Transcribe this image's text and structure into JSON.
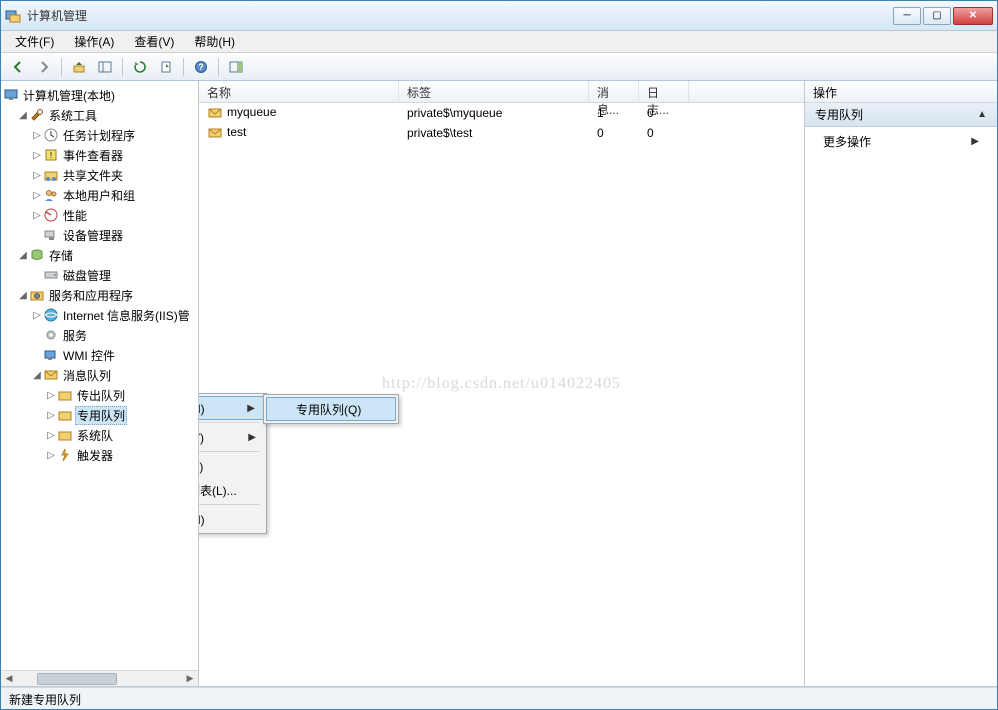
{
  "window": {
    "title": "计算机管理"
  },
  "menu": {
    "file": "文件(F)",
    "action": "操作(A)",
    "view": "查看(V)",
    "help": "帮助(H)"
  },
  "tree": {
    "root": "计算机管理(本地)",
    "system_tools": "系统工具",
    "task_scheduler": "任务计划程序",
    "event_viewer": "事件查看器",
    "shared_folders": "共享文件夹",
    "local_users": "本地用户和组",
    "performance": "性能",
    "device_manager": "设备管理器",
    "storage": "存储",
    "disk_management": "磁盘管理",
    "services_apps": "服务和应用程序",
    "iis": "Internet 信息服务(IIS)管",
    "services": "服务",
    "wmi": "WMI 控件",
    "msmq": "消息队列",
    "outgoing_queues": "传出队列",
    "private_queues": "专用队列",
    "system_queues": "系统队",
    "triggers": "触发器"
  },
  "list": {
    "columns": {
      "name": "名称",
      "tag": "标签",
      "messages": "消息...",
      "log": "日志..."
    },
    "rows": [
      {
        "name": "myqueue",
        "tag": "private$\\myqueue",
        "messages": "1",
        "log": "0"
      },
      {
        "name": "test",
        "tag": "private$\\test",
        "messages": "0",
        "log": "0"
      }
    ]
  },
  "actions": {
    "header": "操作",
    "section": "专用队列",
    "more": "更多操作"
  },
  "context_menu": {
    "new": "新建(N)",
    "view": "查看(V)",
    "refresh": "刷新(F)",
    "export_list": "导出列表(L)...",
    "help": "帮助(H)",
    "submenu_private_queue": "专用队列(Q)"
  },
  "statusbar": {
    "text": "新建专用队列"
  },
  "watermark": "http://blog.csdn.net/u014022405"
}
